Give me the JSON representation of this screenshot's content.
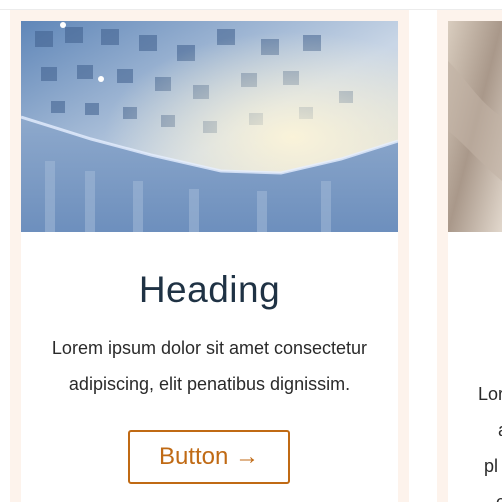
{
  "cards": [
    {
      "image": "ornate coffered dome ceiling",
      "heading": "Heading",
      "body": "Lorem ipsum dolor sit amet consectetur adipiscing, elit penatibus dignissim.",
      "button_label": "Button →"
    },
    {
      "image": "soft blurred marble texture",
      "body_fragments": [
        "Lor",
        "a",
        "pl",
        "c"
      ]
    }
  ],
  "colors": {
    "frame_bg": "#fdf3ec",
    "heading": "#1f3244",
    "button_accent": "#c06a14"
  }
}
